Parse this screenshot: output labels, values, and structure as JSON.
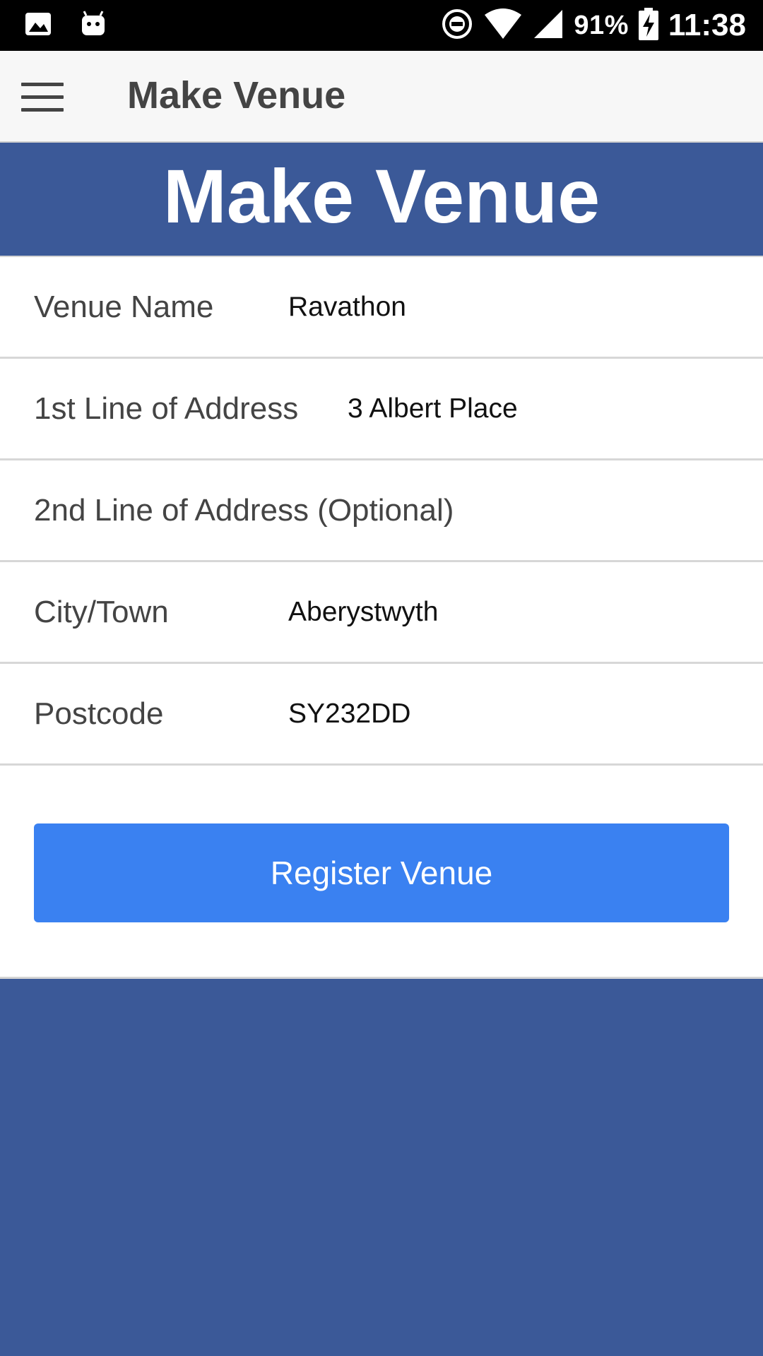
{
  "status_bar": {
    "battery": "91%",
    "time": "11:38",
    "icons": [
      "image-icon",
      "android-icon",
      "do-not-disturb-icon",
      "wifi-icon",
      "signal-icon",
      "battery-charging-icon"
    ]
  },
  "app_bar": {
    "title": "Make Venue"
  },
  "banner": {
    "title": "Make Venue"
  },
  "form": {
    "fields": [
      {
        "label": "Venue Name",
        "value": "Ravathon"
      },
      {
        "label": "1st Line of Address",
        "value": "3 Albert Place"
      },
      {
        "label": "2nd Line of Address (Optional)",
        "value": ""
      },
      {
        "label": "City/Town",
        "value": "Aberystwyth"
      },
      {
        "label": "Postcode",
        "value": "SY232DD"
      }
    ],
    "submit_label": "Register Venue"
  },
  "colors": {
    "brand": "#3b5998",
    "button": "#3a81f1"
  }
}
